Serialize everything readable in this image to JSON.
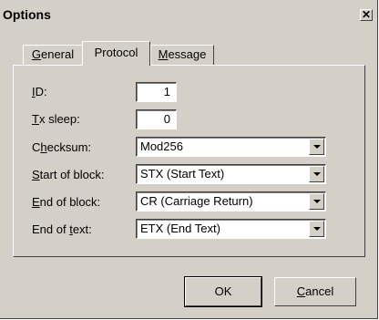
{
  "window": {
    "title": "Options",
    "close_glyph": "✕"
  },
  "tabs": [
    {
      "prefix": "",
      "accel": "G",
      "rest": "eneral",
      "active": false
    },
    {
      "prefix": "",
      "accel": "",
      "rest": "Protocol",
      "active": true
    },
    {
      "prefix": "",
      "accel": "M",
      "rest": "essage",
      "active": false
    }
  ],
  "fields": {
    "id": {
      "label_accel": "I",
      "label_rest": "D:",
      "value": "1"
    },
    "tx_sleep": {
      "label_accel": "T",
      "label_rest": "x sleep:",
      "value": "0"
    },
    "checksum": {
      "label_pre": "C",
      "label_accel": "h",
      "label_rest": "ecksum:",
      "value": "Mod256"
    },
    "start_of_block": {
      "label_accel": "S",
      "label_rest": "tart of block:",
      "value": "STX (Start Text)"
    },
    "end_of_block": {
      "label_accel": "E",
      "label_rest": "nd of block:",
      "value": "CR (Carriage Return)"
    },
    "end_of_text": {
      "label_pre": "End of ",
      "label_accel": "t",
      "label_rest": "ext:",
      "value": "ETX (End Text)"
    }
  },
  "buttons": {
    "ok": "OK",
    "cancel_accel": "C",
    "cancel_rest": "ancel"
  },
  "icons": {
    "close": "close-icon",
    "dropdown": "chevron-down-icon"
  }
}
